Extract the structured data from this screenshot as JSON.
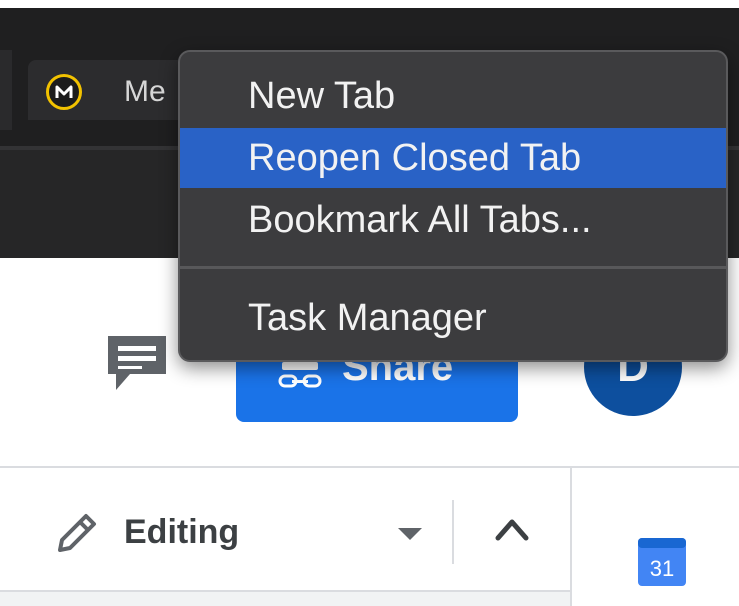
{
  "browser": {
    "tab": {
      "title": "Me",
      "favicon": "letter-m-circle-icon"
    }
  },
  "context_menu": {
    "items": [
      {
        "label": "New Tab",
        "selected": false
      },
      {
        "label": "Reopen Closed Tab",
        "selected": true
      },
      {
        "label": "Bookmark All Tabs...",
        "selected": false
      },
      {
        "label": "Task Manager",
        "selected": false
      }
    ]
  },
  "doc_header": {
    "comment_icon": "comment-icon",
    "share": {
      "label": "Share",
      "icon": "link-icon"
    },
    "avatar": {
      "initial": "D"
    }
  },
  "doc_toolbar": {
    "mode": {
      "label": "Editing",
      "icon": "pencil-icon"
    },
    "collapse_icon": "chevron-up-icon"
  },
  "side_panel": {
    "calendar": {
      "date": "31"
    }
  },
  "colors": {
    "menu_highlight": "#2962c6",
    "share_button": "#1a73e8",
    "avatar": "#0d4f9e",
    "favicon_ring": "#f2c200"
  }
}
